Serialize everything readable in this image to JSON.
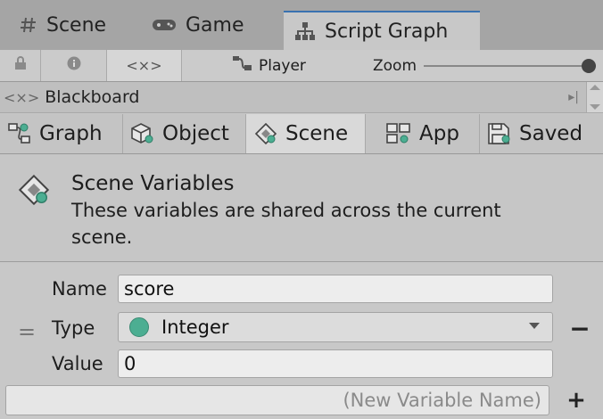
{
  "tabs": {
    "scene": "Scene",
    "game": "Game",
    "script_graph": "Script Graph"
  },
  "toolbar": {
    "player": "Player",
    "zoom_label": "Zoom",
    "zoom_value": 1.0
  },
  "blackboard": {
    "title": "Blackboard"
  },
  "var_tabs": [
    "Graph",
    "Object",
    "Scene",
    "App",
    "Saved"
  ],
  "active_tab": "Scene",
  "info": {
    "title": "Scene Variables",
    "description": "These variables are shared across the current scene."
  },
  "variable": {
    "name_label": "Name",
    "name_value": "score",
    "type_label": "Type",
    "type_value": "Integer",
    "value_label": "Value",
    "value_value": "0"
  },
  "new_variable": {
    "placeholder": "(New Variable Name)"
  },
  "colors": {
    "tab_accent": "#3a72b0",
    "integer_dot": "#4cae92"
  }
}
